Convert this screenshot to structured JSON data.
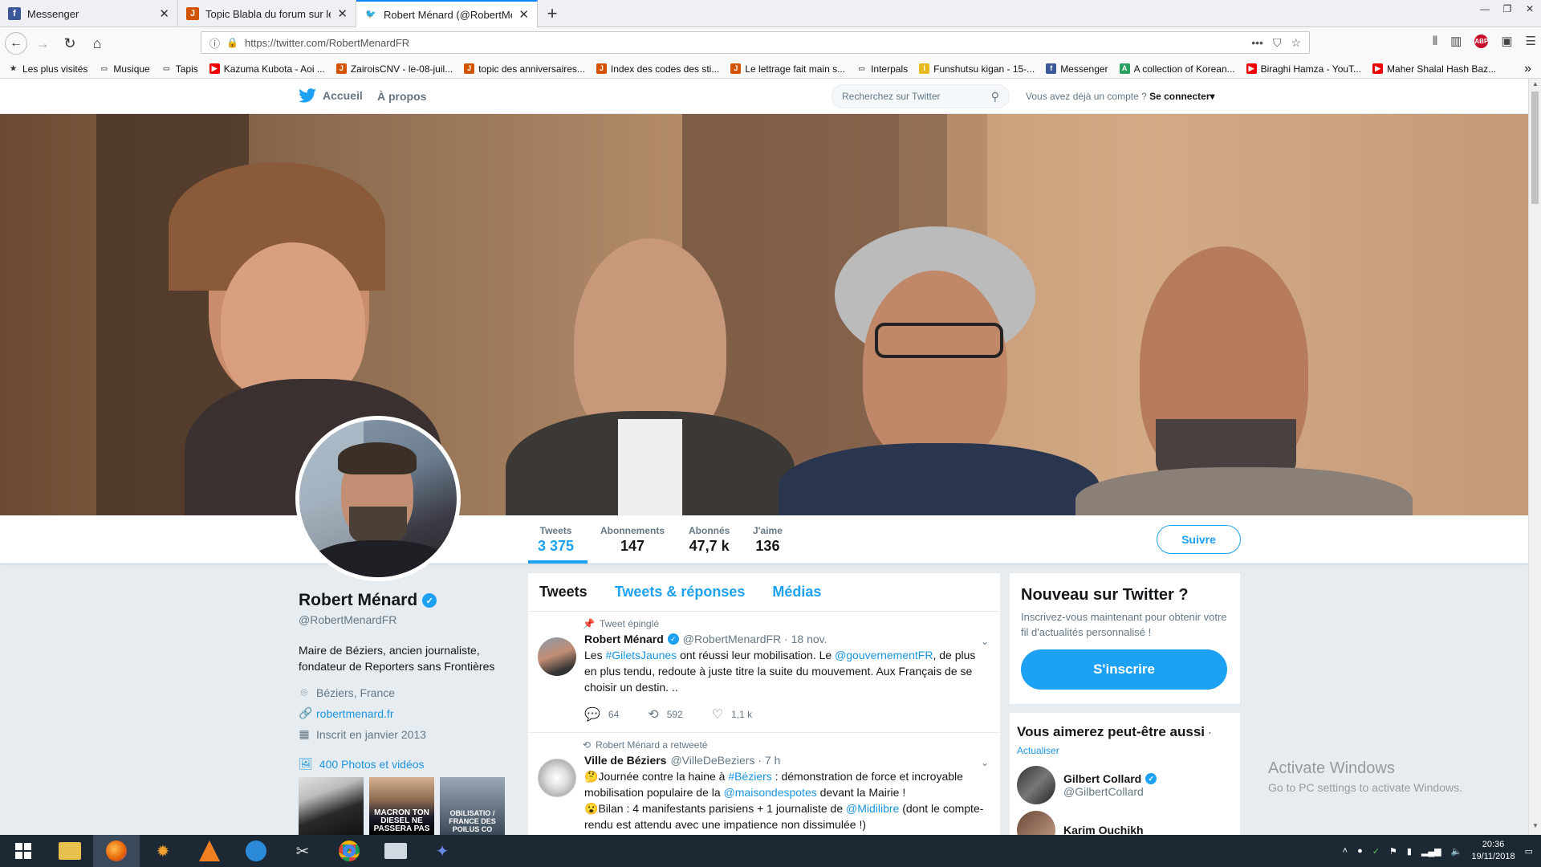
{
  "browser": {
    "tabs": [
      {
        "title": "Messenger",
        "favicon": "facebook-icon",
        "color": "#3b5998",
        "active": false
      },
      {
        "title": "Topic Blabla du forum sur le fo",
        "favicon": "jvc-icon",
        "color": "#d35400",
        "active": false
      },
      {
        "title": "Robert Ménard (@RobertMéna",
        "favicon": "twitter-icon",
        "color": "#1da1f2",
        "active": true
      }
    ],
    "url": "https://twitter.com/RobertMenardFR",
    "bookmarks": [
      {
        "label": "Les plus visités",
        "icon": "star-icon"
      },
      {
        "label": "Musique",
        "icon": "folder-icon"
      },
      {
        "label": "Tapis",
        "icon": "folder-icon"
      },
      {
        "label": "Kazuma Kubota - Aoi ...",
        "icon": "youtube-icon"
      },
      {
        "label": "ZairoisCNV - le-08-juil...",
        "icon": "jvc-icon"
      },
      {
        "label": "topic des anniversaires...",
        "icon": "jvc-icon"
      },
      {
        "label": "Index des codes des sti...",
        "icon": "jvc-icon"
      },
      {
        "label": "Le lettrage fait main s...",
        "icon": "jvc-icon"
      },
      {
        "label": "Interpals",
        "icon": "folder-icon"
      },
      {
        "label": "Funshutsu kigan - 15-...",
        "icon": "imdb-icon"
      },
      {
        "label": "Messenger",
        "icon": "facebook-icon"
      },
      {
        "label": "A collection of Korean...",
        "icon": "green-icon"
      },
      {
        "label": "Biraghi Hamza - YouT...",
        "icon": "youtube-icon"
      },
      {
        "label": "Maher Shalal Hash Baz...",
        "icon": "youtube-icon"
      }
    ]
  },
  "twitter_nav": {
    "home": "Accueil",
    "about": "À propos",
    "search_placeholder": "Recherchez sur Twitter",
    "login_prompt": "Vous avez déjà un compte ?",
    "login_link": "Se connecter"
  },
  "profile": {
    "name": "Robert Ménard",
    "handle": "@RobertMenardFR",
    "bio": "Maire de Béziers, ancien journaliste, fondateur de Reporters sans Frontières",
    "location": "Béziers, France",
    "website": "robertmenard.fr",
    "joined": "Inscrit en janvier 2013",
    "photos_label": "400 Photos et vidéos",
    "follow_label": "Suivre",
    "stats": [
      {
        "label": "Tweets",
        "value": "3 375"
      },
      {
        "label": "Abonnements",
        "value": "147"
      },
      {
        "label": "Abonnés",
        "value": "47,7 k"
      },
      {
        "label": "J'aime",
        "value": "136"
      }
    ],
    "thumbs": [
      "",
      "MACRON TON DIESEL NE PASSERA PAS",
      "OBILISATIO / FRANCE DES POILUS CO"
    ]
  },
  "timeline": {
    "tabs": [
      "Tweets",
      "Tweets & réponses",
      "Médias"
    ],
    "tweets": [
      {
        "context": "Tweet épinglé",
        "author": "Robert Ménard",
        "meta": "@RobertMenardFR · 18 nov.",
        "text_parts": [
          "Les ",
          "#GiletsJaunes",
          " ont réussi leur mobilisation. Le ",
          "@gouvernementFR",
          ", de plus en plus tendu, redoute à juste titre la suite du mouvement. Aux Français de se choisir un destin. .."
        ],
        "replies": "64",
        "retweets": "592",
        "likes": "1,1 k"
      },
      {
        "context": "Robert Ménard a retweeté",
        "author": "Ville de Béziers",
        "meta": "@VilleDeBeziers · 7 h",
        "line1": [
          "Journée contre la haine à ",
          "#Béziers",
          " : démonstration de force et incroyable mobilisation populaire de la ",
          "@maisondespotes",
          " devant la Mairie !"
        ],
        "line2": [
          "Bilan : 4 manifestants parisiens + 1 journaliste de ",
          "@Midilibre",
          " (dont le compte-rendu est attendu avec une impatience non dissimulée !)"
        ]
      }
    ]
  },
  "signup": {
    "title": "Nouveau sur Twitter ?",
    "text": "Inscrivez-vous maintenant pour obtenir votre fil d'actualités personnalisé !",
    "button": "S'inscrire"
  },
  "who_to_follow": {
    "title": "Vous aimerez peut-être aussi",
    "refresh": "Actualiser",
    "users": [
      {
        "name": "Gilbert Collard",
        "handle": "@GilbertCollard",
        "verified": true
      },
      {
        "name": "Karim Ouchikh",
        "handle": "",
        "verified": false
      }
    ]
  },
  "watermark": {
    "line1": "Activate Windows",
    "line2": "Go to PC settings to activate Windows."
  },
  "taskbar": {
    "time": "20:36",
    "date": "19/11/2018"
  }
}
